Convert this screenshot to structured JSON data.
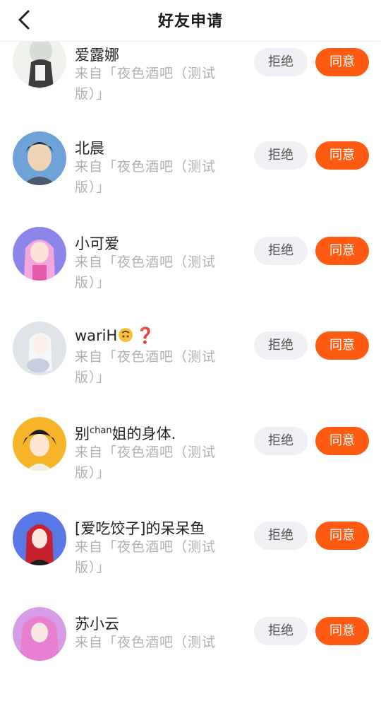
{
  "header": {
    "title": "好友申请",
    "back_label": "返回"
  },
  "buttons": {
    "reject": "拒绝",
    "agree": "同意"
  },
  "requests": [
    {
      "name": "爱露娜",
      "source": "来自「夜色酒吧（测试版）」",
      "avatar_color": "#eef1ec"
    },
    {
      "name": "北晨",
      "source": "来自「夜色酒吧（测试版）」",
      "avatar_color": "#6fa3d8"
    },
    {
      "name": "小可爱",
      "source": "来自「夜色酒吧（测试版）」",
      "avatar_color": "#8b86e8"
    },
    {
      "name": "wariH",
      "emoji": "🙃",
      "emoji2": "❓",
      "source": "来自「夜色酒吧（测试版）」",
      "avatar_color": "#dfe4ea"
    },
    {
      "name_prefix": "别",
      "name_sup": "chan",
      "name_suffix": "姐的身体.",
      "source": "来自「夜色酒吧（测试版）」",
      "avatar_color": "#f6b428"
    },
    {
      "name": "[爱吃饺子]的呆呆鱼",
      "source": "来自「夜色酒吧（测试版）」",
      "avatar_color": "#5a77e6"
    },
    {
      "name": "苏小云",
      "source": "来自「夜色酒吧（测试",
      "avatar_color": "#d89ce6"
    }
  ]
}
